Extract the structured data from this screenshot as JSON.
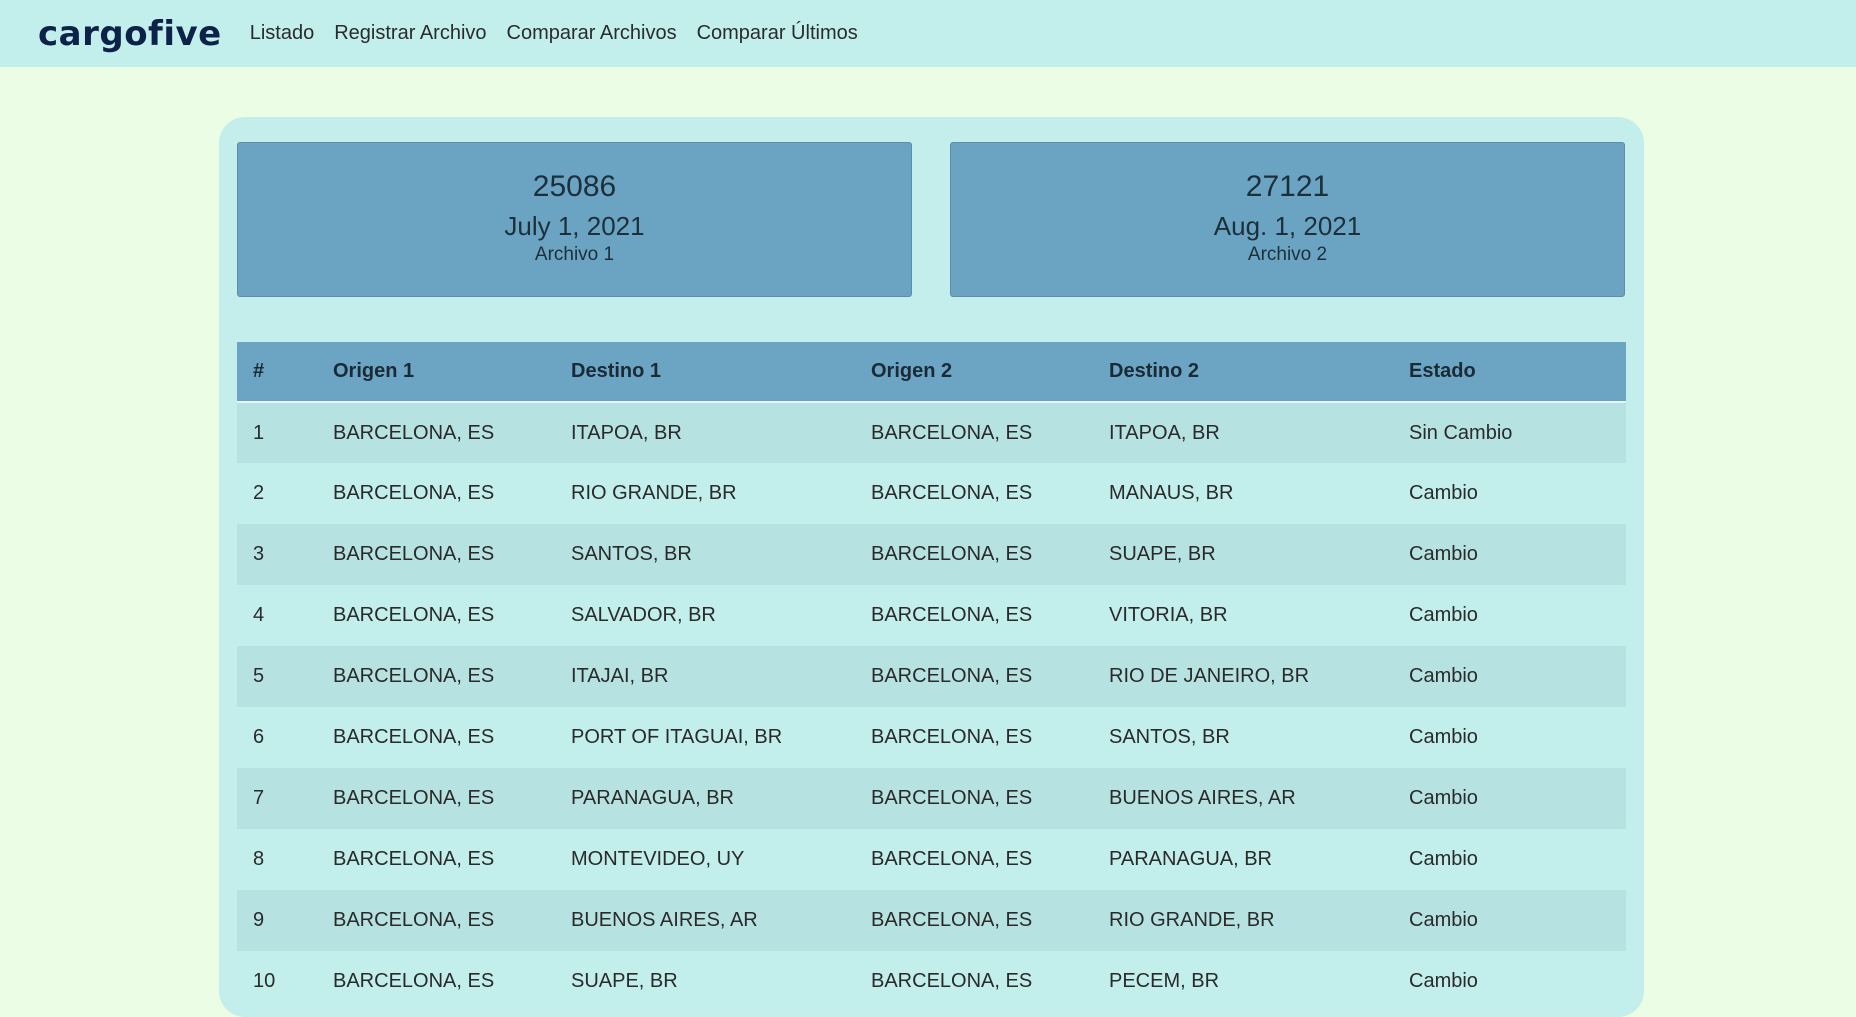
{
  "nav": {
    "brand": "cargofive",
    "links": [
      "Listado",
      "Registrar Archivo",
      "Comparar Archivos",
      "Comparar Últimos"
    ]
  },
  "files": [
    {
      "id": "25086",
      "date": "July 1, 2021",
      "label": "Archivo 1"
    },
    {
      "id": "27121",
      "date": "Aug. 1, 2021",
      "label": "Archivo 2"
    }
  ],
  "table": {
    "headers": [
      "#",
      "Origen 1",
      "Destino 1",
      "Origen 2",
      "Destino 2",
      "Estado"
    ],
    "rows": [
      [
        "1",
        "BARCELONA, ES",
        "ITAPOA, BR",
        "BARCELONA, ES",
        "ITAPOA, BR",
        "Sin Cambio"
      ],
      [
        "2",
        "BARCELONA, ES",
        "RIO GRANDE, BR",
        "BARCELONA, ES",
        "MANAUS, BR",
        "Cambio"
      ],
      [
        "3",
        "BARCELONA, ES",
        "SANTOS, BR",
        "BARCELONA, ES",
        "SUAPE, BR",
        "Cambio"
      ],
      [
        "4",
        "BARCELONA, ES",
        "SALVADOR, BR",
        "BARCELONA, ES",
        "VITORIA, BR",
        "Cambio"
      ],
      [
        "5",
        "BARCELONA, ES",
        "ITAJAI, BR",
        "BARCELONA, ES",
        "RIO DE JANEIRO, BR",
        "Cambio"
      ],
      [
        "6",
        "BARCELONA, ES",
        "PORT OF ITAGUAI, BR",
        "BARCELONA, ES",
        "SANTOS, BR",
        "Cambio"
      ],
      [
        "7",
        "BARCELONA, ES",
        "PARANAGUA, BR",
        "BARCELONA, ES",
        "BUENOS AIRES, AR",
        "Cambio"
      ],
      [
        "8",
        "BARCELONA, ES",
        "MONTEVIDEO, UY",
        "BARCELONA, ES",
        "PARANAGUA, BR",
        "Cambio"
      ],
      [
        "9",
        "BARCELONA, ES",
        "BUENOS AIRES, AR",
        "BARCELONA, ES",
        "RIO GRANDE, BR",
        "Cambio"
      ],
      [
        "10",
        "BARCELONA, ES",
        "SUAPE, BR",
        "BARCELONA, ES",
        "PECEM, BR",
        "Cambio"
      ]
    ]
  }
}
